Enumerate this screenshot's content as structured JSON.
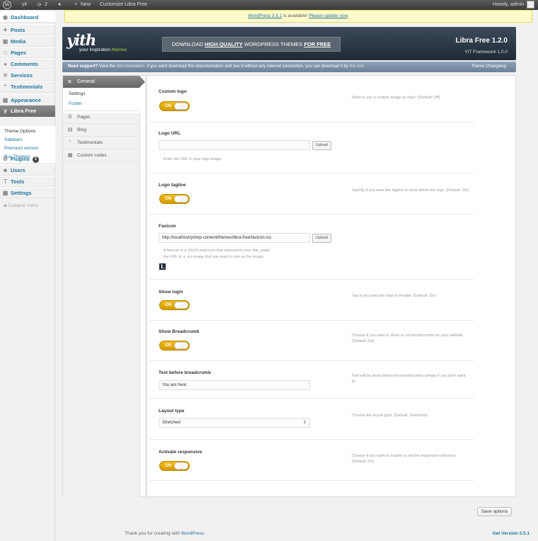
{
  "adminbar": {
    "site": "yit",
    "updates_count": "2",
    "new_label": "New",
    "customize_label": "Customize Libra Free",
    "howdy": "Howdy, admin"
  },
  "sidebar": {
    "items": [
      {
        "label": "Dashboard",
        "icon": "dashboard-icon"
      },
      {
        "label": "Posts",
        "icon": "pin-icon"
      },
      {
        "label": "Media",
        "icon": "media-icon"
      },
      {
        "label": "Pages",
        "icon": "page-icon"
      },
      {
        "label": "Comments",
        "icon": "comment-icon"
      },
      {
        "label": "Services",
        "icon": "wrench-icon"
      },
      {
        "label": "Testimonials",
        "icon": "quote-icon"
      },
      {
        "label": "Appearance",
        "icon": "brush-icon"
      },
      {
        "label": "Libra Free",
        "icon": "yit-icon"
      },
      {
        "label": "Plugins",
        "icon": "plug-icon"
      },
      {
        "label": "Users",
        "icon": "users-icon"
      },
      {
        "label": "Tools",
        "icon": "tools-icon"
      },
      {
        "label": "Settings",
        "icon": "settings-icon"
      }
    ],
    "subitems": [
      "Theme Options",
      "Sidebars",
      "Premium version",
      "Buy Themes"
    ],
    "plugins_badge": "1",
    "collapse": "Collapse menu"
  },
  "notice": {
    "link1": "WordPress 3.5.1",
    "middle": " is available! ",
    "link2": "Please update now",
    "end": "."
  },
  "banner": {
    "logo": "yith",
    "tagline_a": "your inspiration ",
    "tagline_b": "themes",
    "promo_a": "DOWNLOAD ",
    "promo_b": "HIGH QUALITY",
    "promo_c": " WORDPRESS THEMES ",
    "promo_d": "FOR FREE",
    "title": "Libra Free 1.2.0",
    "framework": "YIT Framework 1.0.0"
  },
  "support": {
    "bold": "Need support?",
    "t1": " View the ",
    "link1": "documentation",
    "t2": ". If you want download this documentation and see it without any internet connection, you can download it by ",
    "link2": "this link",
    "t3": ".",
    "changelog": "Theme Changelog"
  },
  "tabs": {
    "general": "General",
    "settings": "Settings",
    "footer": "Footer",
    "pages": "Pages",
    "blog": "Blog",
    "testimonials": "Testimonials",
    "custom_codes": "Custom codes"
  },
  "options": {
    "custom_logo": {
      "label": "Custom logo",
      "toggle": "ON",
      "desc": "Want to use a custom image as logo? (Default: Off)"
    },
    "logo_url": {
      "label": "Logo URL",
      "value": "",
      "upload": "Upload",
      "hint": "Enter the URL to your logo image."
    },
    "logo_tagline": {
      "label": "Logo tagline",
      "toggle": "ON",
      "desc": "Specify if you want the tagline to show below the logo. (Default: On)"
    },
    "favicon": {
      "label": "Favicon",
      "value": "http://localhost/yit/wp-content/themes/libra-free/favicon.ico",
      "upload": "Upload",
      "hint1": "A favicon is a 16x16 pixel icon that represents your site; paste",
      "hint2": "the URL to a .ico image that you want to use as the image."
    },
    "show_login": {
      "label": "Show login",
      "toggle": "ON",
      "desc": "Say if you want the login in header. (Default: On)"
    },
    "show_breadcrumb": {
      "label": "Show Breadcrumb",
      "toggle": "ON",
      "desc": "Choose if you want to show or not breadcrumbs on your website. (Default: On)"
    },
    "text_breadcrumb": {
      "label": "Text before breadcrumb",
      "value": "You are here:",
      "desc": "Text will be show before the breadcrumbs (empty if you don't want it)."
    },
    "layout_type": {
      "label": "Layout type",
      "value": "Stretched",
      "desc": "Choose the layout type. (Default: Stretched)"
    },
    "responsive": {
      "label": "Activate responsive",
      "toggle": "ON",
      "desc": "Choose if you want to enable or not the responsive behavior. (Default: On)"
    }
  },
  "save_label": "Save options",
  "footer": {
    "thanks": "Thank you for creating with ",
    "wp": "WordPress",
    "dot": ".",
    "version": "Get Version 3.5.1"
  }
}
